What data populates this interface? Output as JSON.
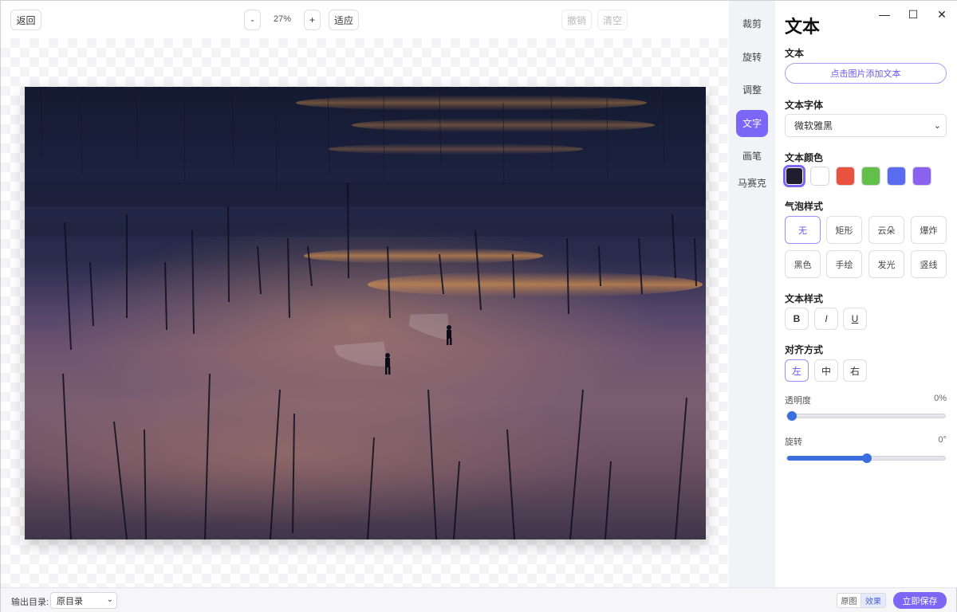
{
  "toolbar": {
    "back": "返回",
    "zoom_out": "-",
    "zoom": "27%",
    "zoom_in": "+",
    "fit": "适应",
    "undo": "撤销",
    "clear": "清空"
  },
  "tools": [
    "裁剪",
    "旋转",
    "调整",
    "文字",
    "画笔",
    "马赛克"
  ],
  "active_tool": "文字",
  "window_controls": {
    "minimize": "—",
    "maximize": "☐",
    "close": "✕"
  },
  "panel": {
    "title": "文本",
    "text_section": "文本",
    "add_text": "点击图片添加文本",
    "font_section": "文本字体",
    "font_value": "微软雅黑",
    "color_section": "文本颜色",
    "colors": [
      "#1e1e2e",
      "#ffffff",
      "#e8523f",
      "#62c04a",
      "#5a6cf0",
      "#8a62ee"
    ],
    "selected_color": "#1e1e2e",
    "bubble_section": "气泡样式",
    "bubbles": [
      "无",
      "矩形",
      "云朵",
      "爆炸",
      "黑色",
      "手绘",
      "发光",
      "竖线"
    ],
    "selected_bubble": "无",
    "style_section": "文本样式",
    "styles": {
      "bold": "B",
      "italic": "I",
      "underline": "U"
    },
    "align_section": "对齐方式",
    "aligns": [
      "左",
      "中",
      "右"
    ],
    "selected_align": "左",
    "opacity_label": "透明度",
    "opacity_value": "0%",
    "opacity_level": 0,
    "rotation_label": "旋转",
    "rotation_value": "0°",
    "rotation_level": 0.5
  },
  "statusbar": {
    "output_label": "输出目录:",
    "output_value": "原目录",
    "original": "原图",
    "effect": "效果",
    "save": "立即保存"
  },
  "colors": {
    "accent": "#7b66f6",
    "slider": "#3b6fe0"
  }
}
